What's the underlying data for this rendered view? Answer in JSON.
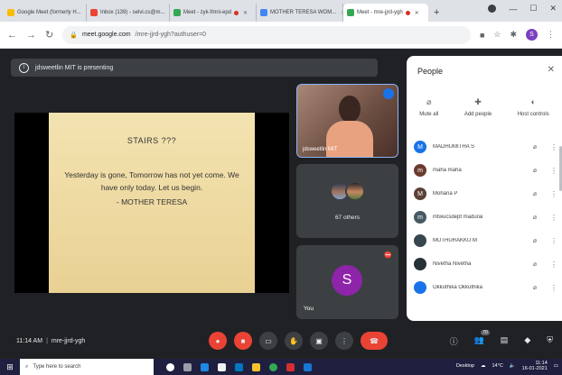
{
  "browser": {
    "tabs": [
      {
        "label": "Google Meet (formerly H...",
        "fav_color": "#fbbc04"
      },
      {
        "label": "Inbox (139) - selvi.cs@m...",
        "fav_color": "#ea4335"
      },
      {
        "label": "Meet - zyk-fmni-epd",
        "fav_color": "#34a853"
      },
      {
        "label": "MOTHER TERESA WOM...",
        "fav_color": "#4285f4"
      },
      {
        "label": "Meet - mre-jjrd-ygh",
        "fav_color": "#34a853"
      }
    ],
    "url_domain": "meet.google.com",
    "url_path": "/mre-jjrd-ygh?authuser=0",
    "profile_initial": "S"
  },
  "meet": {
    "presenting_banner": "jdsweetlin MIT is presenting",
    "slide": {
      "title": "STAIRS ???",
      "body": "Yesterday is gone, Tomorrow has not yet come. We have only today. Let us begin.",
      "author": "- MOTHER TERESA"
    },
    "camera_tile_name": "jdsweetlin MIT",
    "others_label": "67 others",
    "you_initial": "S",
    "you_label": "You",
    "time": "11:14 AM",
    "meeting_code": "mre-jjrd-ygh",
    "participants_badge": "70"
  },
  "people_panel": {
    "title": "People",
    "actions": [
      {
        "label": "Mute all",
        "icon": "mic-off-icon"
      },
      {
        "label": "Add people",
        "icon": "add-person-icon"
      },
      {
        "label": "Host controls",
        "icon": "host-controls-icon"
      }
    ],
    "participants": [
      {
        "name": "MADHUMITHA S",
        "initial": "M",
        "color": "#1a73e8"
      },
      {
        "name": "maha maha",
        "initial": "m",
        "color": "#6d3b2e"
      },
      {
        "name": "Mohana P",
        "initial": "M",
        "color": "#5d4037"
      },
      {
        "name": "mtwucsdept madurai",
        "initial": "m",
        "color": "#455a64"
      },
      {
        "name": "MUTHURAKKU M",
        "initial": "",
        "color": "#37474f"
      },
      {
        "name": "Nivetha Nivetha",
        "initial": "",
        "color": "#263238"
      },
      {
        "name": "Okkuthika Okkuthika",
        "initial": "",
        "color": "#1a73e8"
      }
    ]
  },
  "taskbar": {
    "search_placeholder": "Type here to search",
    "weather": "14°C",
    "desktop": "Desktop",
    "clock_time": "11:14",
    "clock_date": "16-01-2021"
  }
}
